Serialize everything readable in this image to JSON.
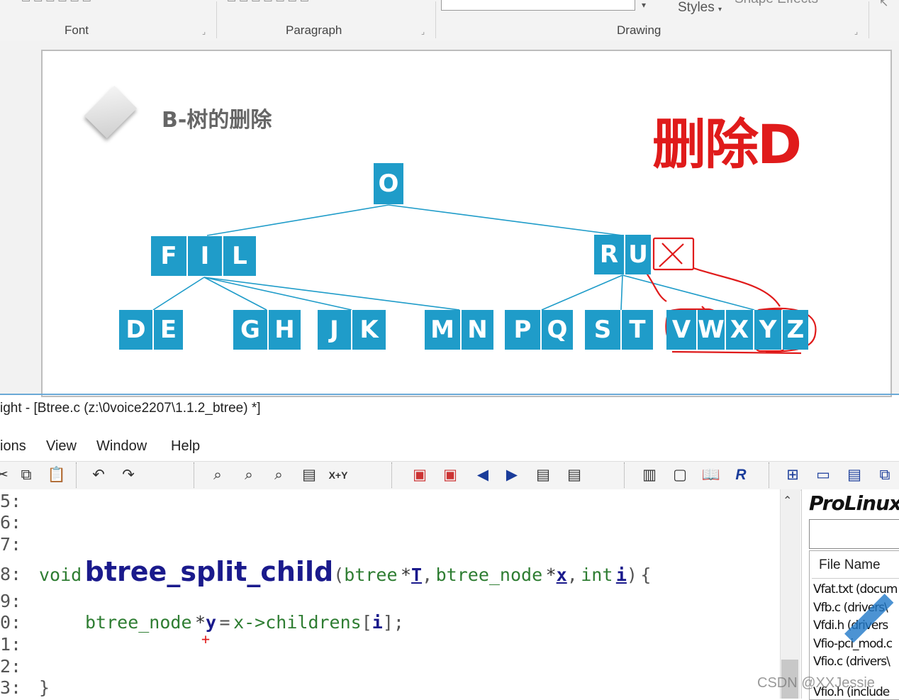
{
  "ribbon": {
    "groups": {
      "font": "Font",
      "paragraph": "Paragraph",
      "drawing": "Drawing"
    },
    "styles_label": "Styles",
    "shape_effects_label": "Shape Effects"
  },
  "slide": {
    "title": "B-树的删除",
    "annotation": "删除D",
    "tree": {
      "root": [
        "O"
      ],
      "level1": [
        [
          "F",
          "I",
          "L"
        ],
        [
          "R",
          "U"
        ]
      ],
      "leaves": [
        [
          "D",
          "E"
        ],
        [
          "G",
          "H"
        ],
        [
          "J",
          "K"
        ],
        [
          "M",
          "N"
        ],
        [
          "P",
          "Q"
        ],
        [
          "S",
          "T"
        ],
        [
          "V",
          "W",
          "X",
          "Y",
          "Z"
        ]
      ]
    }
  },
  "editor": {
    "title": "ight - [Btree.c (z:\\0voice2207\\1.1.2_btree) *]",
    "menu": [
      "ions",
      "View",
      "Window",
      "Help"
    ],
    "toolbar_icons": [
      "cut-icon",
      "copy-icon",
      "paste-icon",
      "undo-icon",
      "redo-icon",
      "find-icon",
      "find-prev-icon",
      "find-next-icon",
      "find-files-icon",
      "replace-icon",
      "bookmark-prev-icon",
      "bookmark-next-icon",
      "back-icon",
      "forward-icon",
      "jump-back-icon",
      "jump-forward-icon",
      "symbol-icon",
      "browse-icon",
      "book-icon",
      "relation-icon",
      "layout1-icon",
      "layout2-icon",
      "layout3-icon",
      "layout4-icon"
    ],
    "replace_label": "X+Y",
    "line_numbers": [
      "5:",
      "6:",
      "7:",
      "8:",
      "9:",
      "0:",
      "1:",
      "2:",
      "3:"
    ],
    "code": {
      "void": "void",
      "func": "btree_split_child",
      "open": "(",
      "t1": "btree",
      "p1": "*",
      "a1": "T",
      "c1": ",",
      "t2": "btree_node",
      "p2": "*",
      "a2": "x",
      "c2": ",",
      "t3": "int",
      "a3": "i",
      "close": ")",
      "brace_open": "{",
      "l2_type": "btree_node",
      "l2_star": "*",
      "l2_var": "y",
      "l2_eq": "=",
      "l2_x": "x",
      "l2_arrow": "->",
      "l2_field": "childrens",
      "l2_lb": "[",
      "l2_i": "i",
      "l2_rb": "];",
      "brace_close": "}",
      "cursor": "+"
    },
    "panel": {
      "title": "ProLinux",
      "column": "File Name",
      "files": [
        "Vfat.txt (docum",
        "Vfb.c (drivers\\",
        "Vfdi.h (drivers",
        "Vfio-pci_mod.c",
        "Vfio.c (drivers\\",
        "Vfio.h (include"
      ]
    },
    "watermark": "CSDN @XXJessie"
  },
  "colors": {
    "key_blue": "#1f9cc9",
    "annotation_red": "#e01b1b",
    "keyword_green": "#2e7d32",
    "func_blue": "#1a1a8c"
  }
}
